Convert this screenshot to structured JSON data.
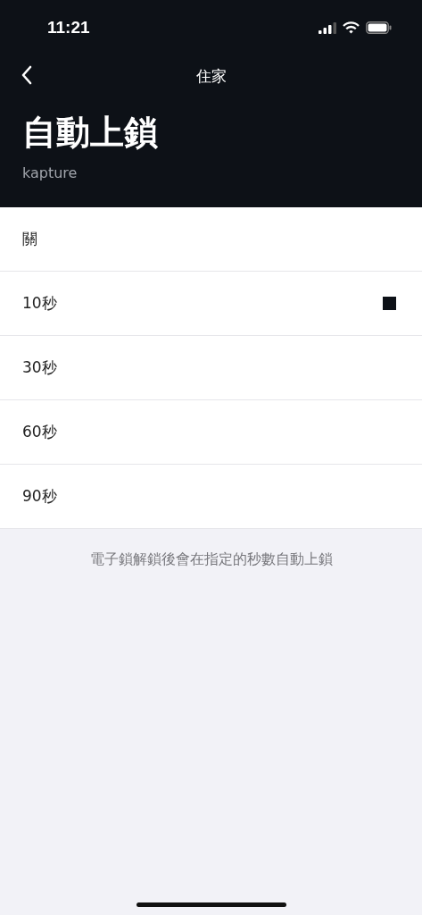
{
  "status_bar": {
    "time": "11:21"
  },
  "nav": {
    "title": "住家"
  },
  "header": {
    "title": "自動上鎖",
    "subtitle": "kapture"
  },
  "options": [
    {
      "label": "關",
      "selected": false
    },
    {
      "label": "10秒",
      "selected": true
    },
    {
      "label": "30秒",
      "selected": false
    },
    {
      "label": "60秒",
      "selected": false
    },
    {
      "label": "90秒",
      "selected": false
    }
  ],
  "footnote": "電子鎖解鎖後會在指定的秒數自動上鎖"
}
